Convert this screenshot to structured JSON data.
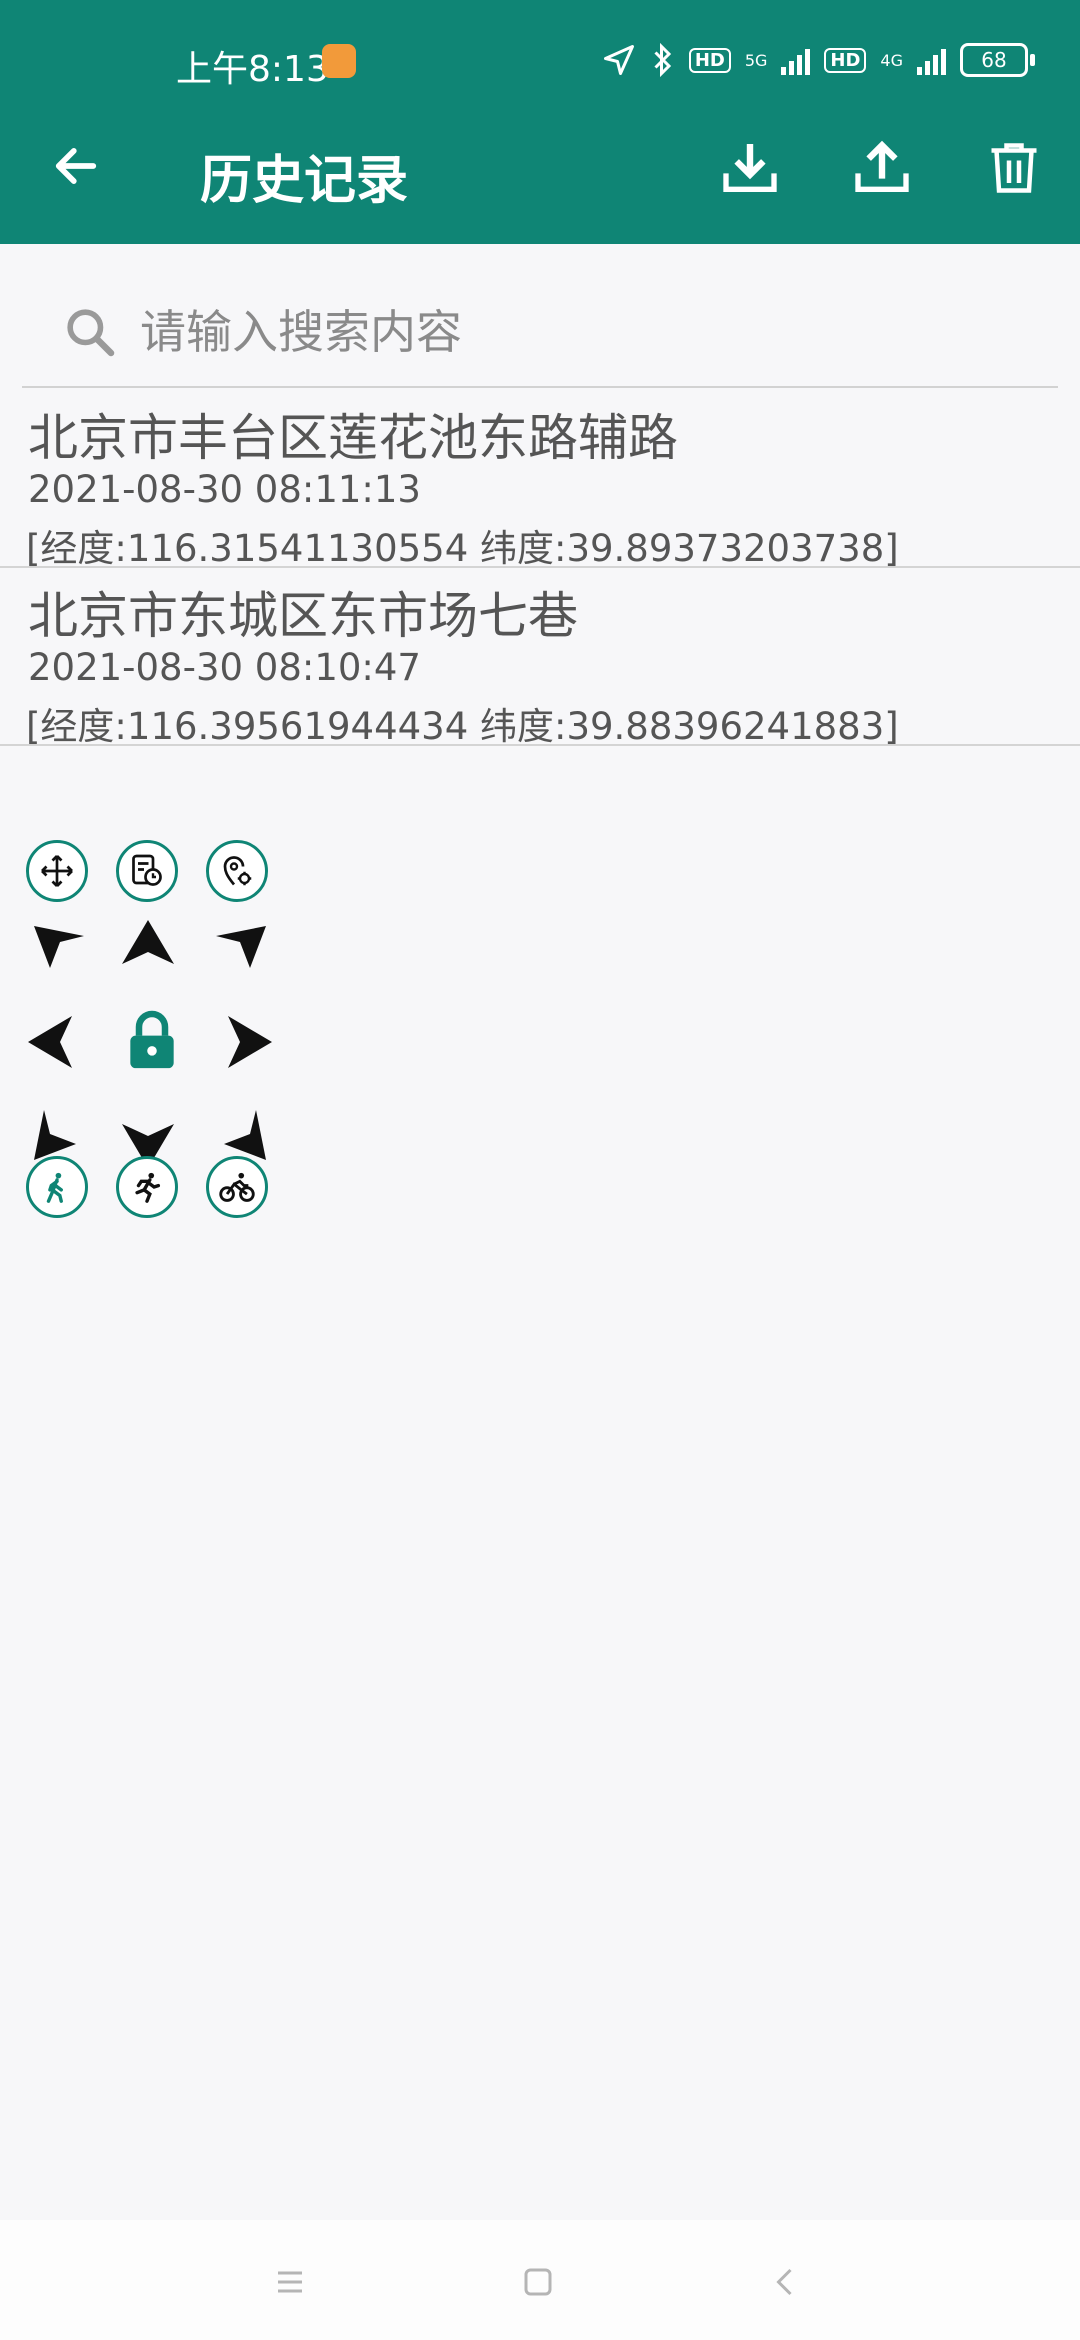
{
  "status_bar": {
    "time": "上午8:13",
    "network1": "5G",
    "network2": "4G",
    "hd_label": "HD",
    "battery": "68"
  },
  "app_bar": {
    "title": "历史记录",
    "back_icon": "arrow-left-icon",
    "actions": [
      "download-icon",
      "upload-icon",
      "trash-icon"
    ]
  },
  "search": {
    "placeholder": "请输入搜索内容",
    "value": ""
  },
  "history": [
    {
      "address": "北京市丰台区莲花池东路辅路",
      "time": "2021-08-30 08:11:13",
      "coords": "[经度:116.31541130554 纬度:39.89373203738]"
    },
    {
      "address": "北京市东城区东市场七巷",
      "time": "2021-08-30 08:10:47",
      "coords": "[经度:116.39561944434 纬度:39.88396241883]"
    }
  ],
  "joystick": {
    "top_buttons": [
      "move-icon",
      "history-clock-icon",
      "location-settings-icon"
    ],
    "bottom_buttons": [
      "walk-icon",
      "run-icon",
      "bike-icon"
    ],
    "center": "lock-icon"
  },
  "colors": {
    "accent": "#0f8575",
    "background": "#f7f7f9"
  }
}
